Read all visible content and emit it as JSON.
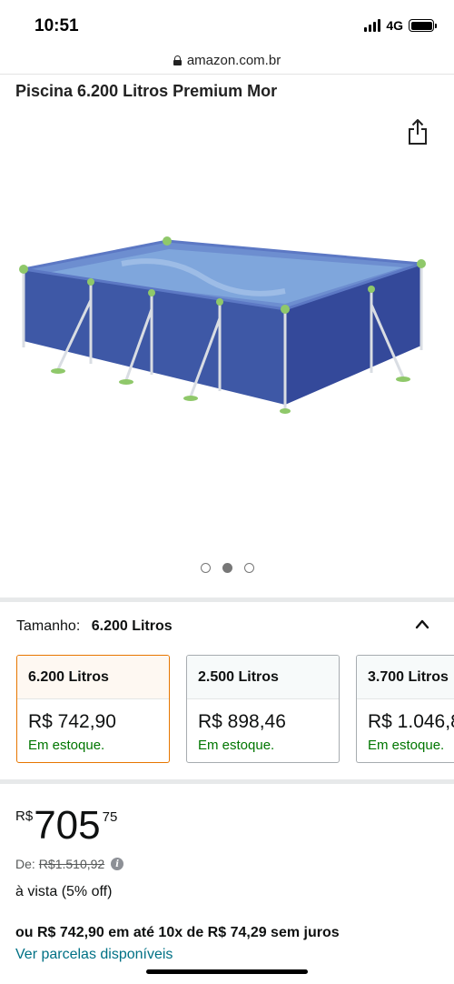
{
  "status_bar": {
    "time": "10:51",
    "network": "4G",
    "icons": [
      "signal-icon",
      "battery-icon"
    ]
  },
  "browser": {
    "url": "amazon.com.br",
    "icon": "lock-icon"
  },
  "product": {
    "title": "Piscina 6.200 Litros Premium Mor",
    "share_icon": "share-icon",
    "image_icon": "pool-image",
    "carousel": {
      "total": 3,
      "active": 1
    }
  },
  "variation": {
    "label": "Tamanho:",
    "selected": "6.200 Litros",
    "toggle_icon": "chevron-up-icon",
    "options": [
      {
        "name": "6.200 Litros",
        "price": "R$ 742,90",
        "stock": "Em estoque.",
        "selected": true
      },
      {
        "name": "2.500 Litros",
        "price": "R$ 898,46",
        "stock": "Em estoque.",
        "selected": false
      },
      {
        "name": "3.700 Litros",
        "price": "R$ 1.046,8",
        "stock": "Em estoque.",
        "selected": false
      }
    ]
  },
  "pricing": {
    "currency": "R$",
    "whole": "705",
    "fraction": "75",
    "list_price_label": "De:",
    "list_price": "R$1.510,92",
    "cash_note": "à vista (5% off)",
    "installments": "ou R$ 742,90 em até 10x de R$ 74,29 sem juros",
    "installments_link": "Ver parcelas disponíveis"
  },
  "colors": {
    "link": "#007185",
    "in_stock": "#007600",
    "selected_border": "#e77600",
    "pool_blue": "#3f59a8",
    "frame_green": "#8fc86a"
  }
}
